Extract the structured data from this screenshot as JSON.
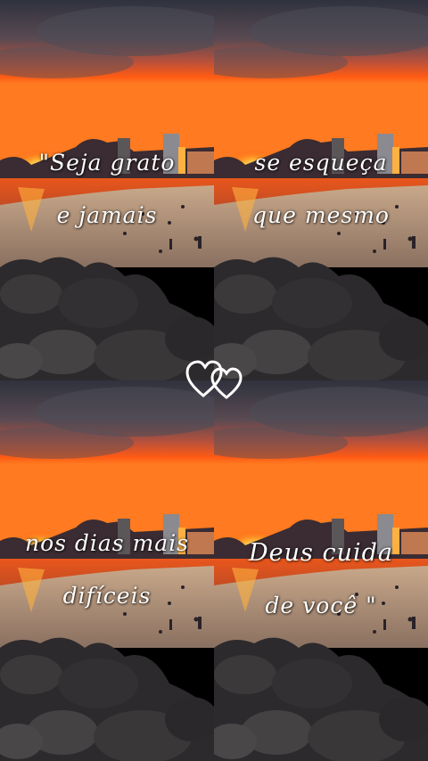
{
  "panels": [
    {
      "line1": "\"Seja grato",
      "line2": "e jamais"
    },
    {
      "line1": "se esqueça",
      "line2": "que mesmo"
    },
    {
      "line1": "nos dias mais",
      "line2": "difíceis"
    },
    {
      "line1": "Deus cuida",
      "line2": "de você \""
    }
  ],
  "overlay": {
    "icon": "double-heart-outline-icon"
  },
  "colors": {
    "sky_top": "#3a3d4a",
    "sunset": "#ff5a14",
    "sea": "#d05020",
    "sand": "#b89a7e",
    "rocks": "#2c2a2c"
  }
}
